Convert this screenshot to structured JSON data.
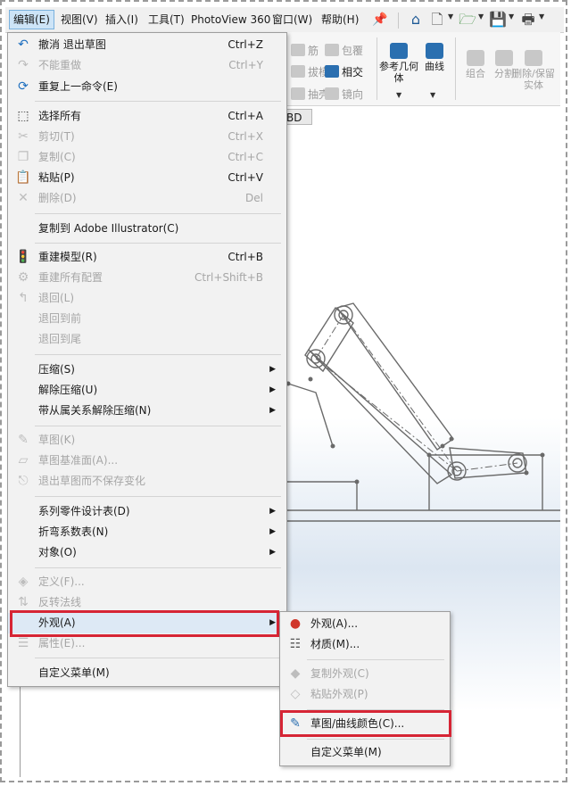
{
  "menubar": {
    "items": [
      "编辑(E)",
      "视图(V)",
      "插入(I)",
      "工具(T)",
      "PhotoView 360",
      "窗口(W)",
      "帮助(H)"
    ]
  },
  "ribbon": {
    "rib": "筋",
    "wrap": "包覆",
    "draft": "拔模",
    "intersect": "相交",
    "shell": "抽壳",
    "mirror": "镜向",
    "ref_geometry": "参考几何体",
    "curves": "曲线",
    "combine": "组合",
    "split": "分割",
    "delete_keep": "删除/保留实体"
  },
  "tab_3d": "BD",
  "edit_menu": {
    "items": [
      {
        "label": "撤消 退出草图",
        "shortcut": "Ctrl+Z",
        "icon": "undo-icon"
      },
      {
        "label": "不能重做",
        "shortcut": "Ctrl+Y",
        "icon": "redo-icon"
      },
      {
        "label": "重复上一命令(E)",
        "shortcut": "",
        "icon": "repeat-icon"
      },
      {
        "label": "选择所有",
        "shortcut": "Ctrl+A",
        "icon": "select-all-icon"
      },
      {
        "label": "剪切(T)",
        "shortcut": "Ctrl+X",
        "icon": "cut-icon"
      },
      {
        "label": "复制(C)",
        "shortcut": "Ctrl+C",
        "icon": "copy-icon"
      },
      {
        "label": "粘贴(P)",
        "shortcut": "Ctrl+V",
        "icon": "paste-icon"
      },
      {
        "label": "删除(D)",
        "shortcut": "Del",
        "icon": "delete-icon"
      },
      {
        "label": "复制到 Adobe Illustrator(C)",
        "shortcut": "",
        "icon": ""
      },
      {
        "label": "重建模型(R)",
        "shortcut": "Ctrl+B",
        "icon": "rebuild-icon"
      },
      {
        "label": "重建所有配置",
        "shortcut": "Ctrl+Shift+B",
        "icon": "rebuild-all-icon"
      },
      {
        "label": "退回(L)",
        "shortcut": "",
        "icon": "rollback-icon"
      },
      {
        "label": "退回到前",
        "shortcut": "",
        "icon": ""
      },
      {
        "label": "退回到尾",
        "shortcut": "",
        "icon": ""
      },
      {
        "label": "压缩(S)",
        "shortcut": "",
        "icon": ""
      },
      {
        "label": "解除压缩(U)",
        "shortcut": "",
        "icon": ""
      },
      {
        "label": "带从属关系解除压缩(N)",
        "shortcut": "",
        "icon": ""
      },
      {
        "label": "草图(K)",
        "shortcut": "",
        "icon": "sketch-icon"
      },
      {
        "label": "草图基准面(A)...",
        "shortcut": "",
        "icon": "sketch-plane-icon"
      },
      {
        "label": "退出草图而不保存变化",
        "shortcut": "",
        "icon": "exit-sketch-icon"
      },
      {
        "label": "系列零件设计表(D)",
        "shortcut": "",
        "icon": ""
      },
      {
        "label": "折弯系数表(N)",
        "shortcut": "",
        "icon": ""
      },
      {
        "label": "对象(O)",
        "shortcut": "",
        "icon": ""
      },
      {
        "label": "定义(F)...",
        "shortcut": "",
        "icon": "define-icon"
      },
      {
        "label": "反转法线",
        "shortcut": "",
        "icon": "flip-normal-icon"
      },
      {
        "label": "外观(A)",
        "shortcut": "",
        "icon": ""
      },
      {
        "label": "属性(E)...",
        "shortcut": "",
        "icon": "properties-icon"
      },
      {
        "label": "自定义菜单(M)",
        "shortcut": "",
        "icon": ""
      }
    ]
  },
  "appearance_submenu": {
    "items": [
      {
        "label": "外观(A)...",
        "icon": "appearance-icon"
      },
      {
        "label": "材质(M)...",
        "icon": "material-icon"
      },
      {
        "label": "复制外观(C)",
        "icon": "copy-appearance-icon"
      },
      {
        "label": "粘贴外观(P)",
        "icon": "paste-appearance-icon"
      },
      {
        "label": "草图/曲线颜色(C)...",
        "icon": "sketch-color-icon"
      },
      {
        "label": "自定义菜单(M)",
        "icon": ""
      }
    ]
  },
  "colors": {
    "highlight_border": "#d62535",
    "menu_bg": "#f2f2f2",
    "accent_blue": "#2a6fb0"
  }
}
